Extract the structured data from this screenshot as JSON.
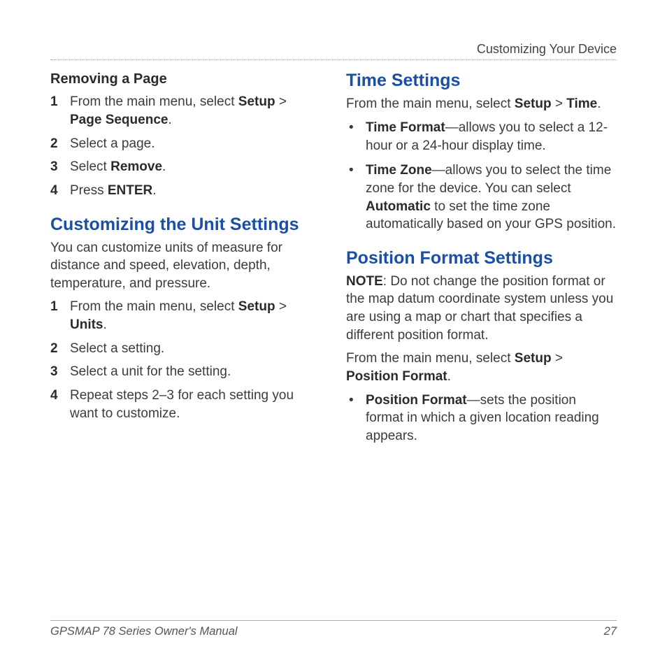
{
  "header": {
    "section": "Customizing Your Device"
  },
  "left": {
    "removing": {
      "heading": "Removing a Page",
      "step1_pre": "From the main menu, select ",
      "step1_b1": "Setup",
      "step1_gt": " > ",
      "step1_b2": "Page Sequence",
      "step1_post": ".",
      "step2": "Select a page.",
      "step3_pre": "Select ",
      "step3_b": "Remove",
      "step3_post": ".",
      "step4_pre": "Press ",
      "step4_b": "ENTER",
      "step4_post": "."
    },
    "unit": {
      "heading": "Customizing the Unit Settings",
      "intro": "You can customize units of measure for distance and speed, elevation, depth, temperature, and pressure.",
      "step1_pre": "From the main menu, select ",
      "step1_b1": "Setup",
      "step1_gt": " > ",
      "step1_b2": "Units",
      "step1_post": ".",
      "step2": "Select a setting.",
      "step3": "Select a unit for the setting.",
      "step4": "Repeat steps 2–3 for each setting you want to customize."
    }
  },
  "right": {
    "time": {
      "heading": "Time Settings",
      "intro_pre": "From the main menu, select ",
      "intro_b1": "Setup",
      "intro_gt": " > ",
      "intro_b2": "Time",
      "intro_post": ".",
      "b1_term": "Time Format",
      "b1_rest": "—allows you to select a 12-hour or a 24-hour display time.",
      "b2_term": "Time Zone",
      "b2_pre": "—allows you to select the time zone for the device. You can select ",
      "b2_auto": "Automatic",
      "b2_post": " to set the time zone automatically based on your GPS position."
    },
    "pos": {
      "heading": "Position Format Settings",
      "note_b": "NOTE",
      "note_rest": ": Do not change the position format or the map datum coordinate system unless you are using a map or chart that specifies a different position format.",
      "intro_pre": "From the main menu, select ",
      "intro_b1": "Setup",
      "intro_gt": " > ",
      "intro_b2": "Position Format",
      "intro_post": ".",
      "b1_term": "Position Format",
      "b1_rest": "—sets the position format in which a given location reading appears."
    }
  },
  "footer": {
    "title": "GPSMAP 78 Series Owner's Manual",
    "page": "27"
  },
  "nums": {
    "n1": "1",
    "n2": "2",
    "n3": "3",
    "n4": "4"
  },
  "bullet": "•"
}
